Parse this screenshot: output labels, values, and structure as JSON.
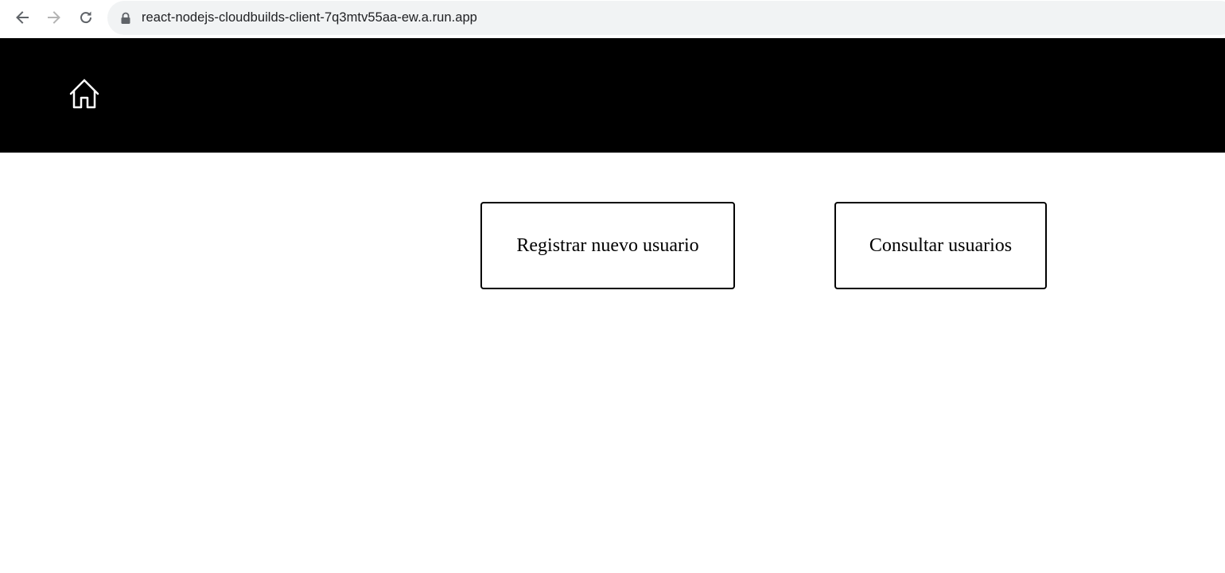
{
  "browser": {
    "url": "react-nodejs-cloudbuilds-client-7q3mtv55aa-ew.a.run.app",
    "icons": {
      "back": "arrow-left-icon",
      "forward": "arrow-right-icon",
      "reload": "reload-icon",
      "security": "lock-icon"
    }
  },
  "header": {
    "home_icon": "home-icon",
    "background": "#000000"
  },
  "main": {
    "register_label": "Registrar nuevo usuario",
    "consult_label": "Consultar usuarios"
  }
}
